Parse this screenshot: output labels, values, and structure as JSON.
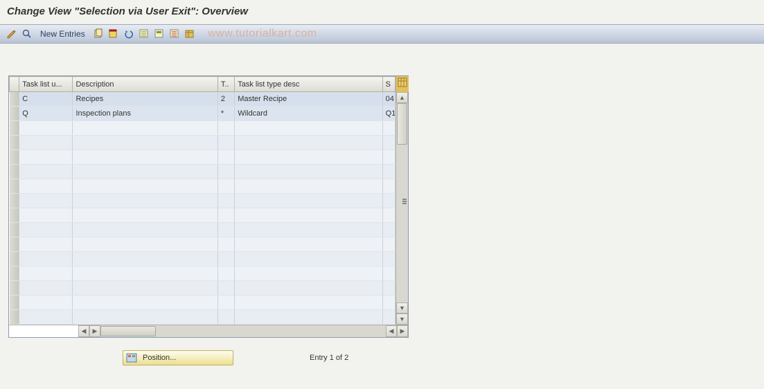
{
  "title": "Change View \"Selection via User Exit\": Overview",
  "toolbar": {
    "new_entries_label": "New Entries"
  },
  "watermark": "www.tutorialkart.com",
  "table": {
    "columns": {
      "usage": "Task list u...",
      "description": "Description",
      "type": "T..",
      "type_desc": "Task list type desc",
      "s": "S"
    },
    "rows": [
      {
        "usage": "C",
        "description": "Recipes",
        "type": "2",
        "type_desc": "Master Recipe",
        "s": "04"
      },
      {
        "usage": "Q",
        "description": "Inspection plans",
        "type": "*",
        "type_desc": "Wildcard",
        "s": "Q1"
      }
    ]
  },
  "footer": {
    "position_label": "Position...",
    "status_text": "Entry 1 of 2"
  }
}
